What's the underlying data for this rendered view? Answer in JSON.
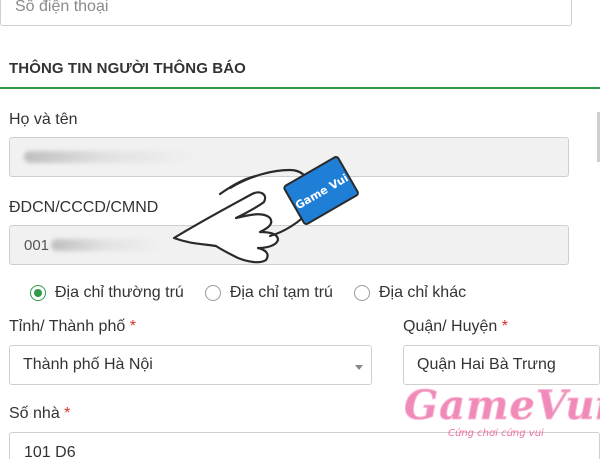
{
  "phone": {
    "placeholder": "Số điện thoại"
  },
  "section": {
    "title": "THÔNG TIN NGƯỜI THÔNG BÁO"
  },
  "fullname": {
    "label": "Họ và tên"
  },
  "idnum": {
    "label": "ĐDCN/CCCD/CMND",
    "value_prefix": "001"
  },
  "address_type": {
    "options": [
      "Địa chỉ thường trú",
      "Địa chỉ tạm trú",
      "Địa chỉ khác"
    ],
    "selected_index": 0
  },
  "province": {
    "label": "Tỉnh/ Thành phố",
    "required_mark": "*",
    "value": "Thành phố Hà Nội"
  },
  "district": {
    "label": "Quận/ Huyện",
    "required_mark": "*",
    "value": "Quận Hai Bà Trưng"
  },
  "house_no": {
    "label": "Số nhà",
    "required_mark": "*",
    "value": "101 D6"
  },
  "watermark": {
    "brand": "GameVui",
    "tagline": "Cứng chơi cứng vui",
    "cuff_text": "Game Vui"
  },
  "colors": {
    "accent": "#2e9a48",
    "required": "#d9302b",
    "logo_pink": "#f08ab8",
    "cuff_blue": "#1f7fd6"
  }
}
